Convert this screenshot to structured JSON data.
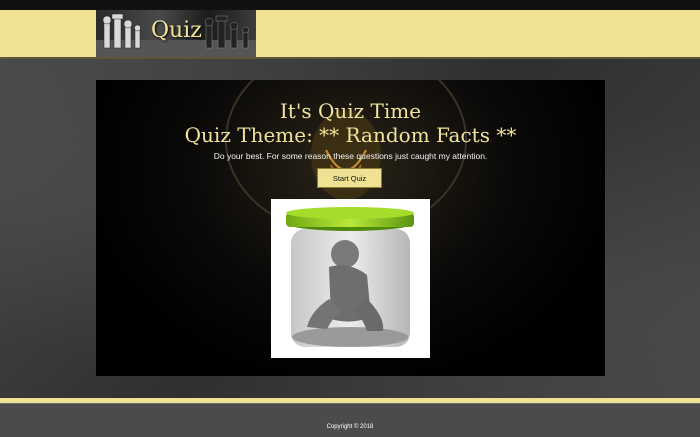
{
  "header": {
    "logo_text": "Quiz",
    "logo_image": "chess-pieces-icon"
  },
  "main": {
    "title_line1": "It's Quiz Time",
    "title_line2": "Quiz Theme: ** Random Facts **",
    "subtitle": "Do your best. For some reason these questions just caught my attention.",
    "start_button_label": "Start Quiz",
    "illustration": "figure-in-jar-icon"
  },
  "footer": {
    "copyright": "Copyright © 2018"
  },
  "colors": {
    "header_bg": "#efe292",
    "accent_text": "#f0e29a",
    "footer_bg": "#4b4b4b",
    "lid_green": "#8cc81e"
  }
}
